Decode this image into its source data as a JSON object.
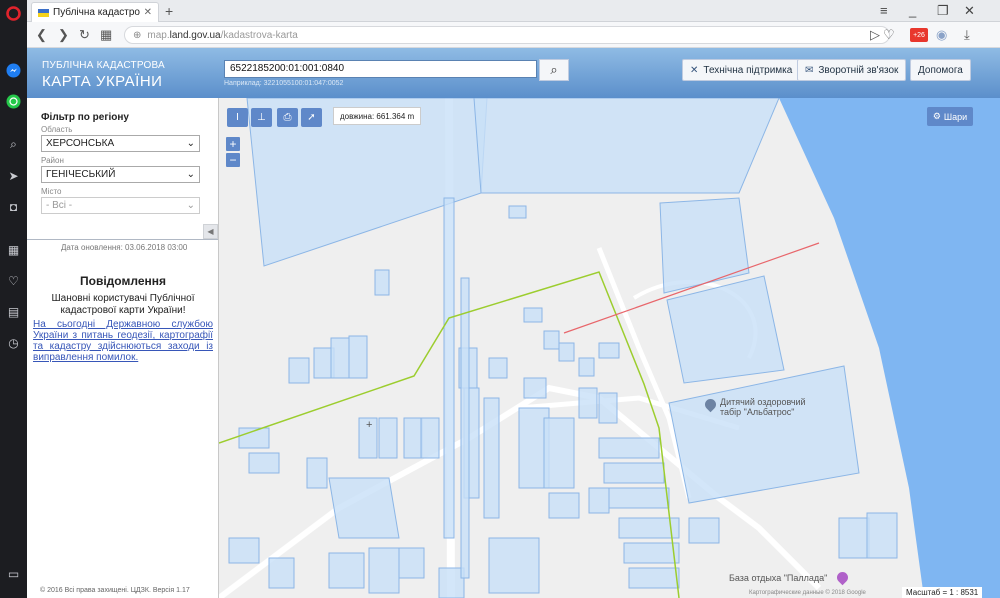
{
  "browser": {
    "tab_title": "Публічна кадастрова кар",
    "url_prefix": "map.",
    "url_domain": "land.gov.ua",
    "url_path": "/kadastrova-karta",
    "badge": "+26",
    "new_tab": "+",
    "close_tab": "✕"
  },
  "header": {
    "logo_small": "ПУБЛІЧНА КАДАСТРОВА",
    "logo_big": "КАРТА УКРАЇНИ",
    "search_value": "6522185200:01:001:0840",
    "search_example": "Наприклад: 3221055100:01:047:0052",
    "btn_support": "Технічна підтримка",
    "btn_feedback": "Зворотній зв'язок",
    "btn_help": "Допомога"
  },
  "filter": {
    "title": "Фільтр по регіону",
    "oblast_label": "Область",
    "oblast_value": "ХЕРСОНСЬКА",
    "rayon_label": "Район",
    "rayon_value": "ГЕНІЧЕСЬКИЙ",
    "city_label": "Місто",
    "city_value": "- Всі -"
  },
  "panel": {
    "update_date": "Дата оновлення: 03.06.2018 03:00",
    "notice_title": "Повідомлення",
    "notice_text": "Шановні користувачі Публічної кадастрової карти України!",
    "notice_link": "На сьогодні Державною службою України з питань геодезії, картографії та кадастру здійснюються заходи із виправлення помилок.",
    "copyright": "© 2016 Всі права захищені. ЦДЗК. Версія 1.17"
  },
  "map": {
    "measure_label": "довжина: 661.364 m",
    "layers_label": "Шари",
    "zoom_in": "+",
    "zoom_out": "−",
    "poi1_line1": "Дитячий оздоровчий",
    "poi1_line2": "табір \"Альбатрос\"",
    "poi2": "База отдыха \"Паллада\"",
    "scale": "Масштаб = 1 : 8531",
    "attribution": "Картографические данные © 2018 Google",
    "measure_line_color": "#e8666b",
    "boundary_color": "#9ccd2e",
    "parcel_color": "#a9cbf0",
    "sea_color": "#7fb6f2"
  }
}
